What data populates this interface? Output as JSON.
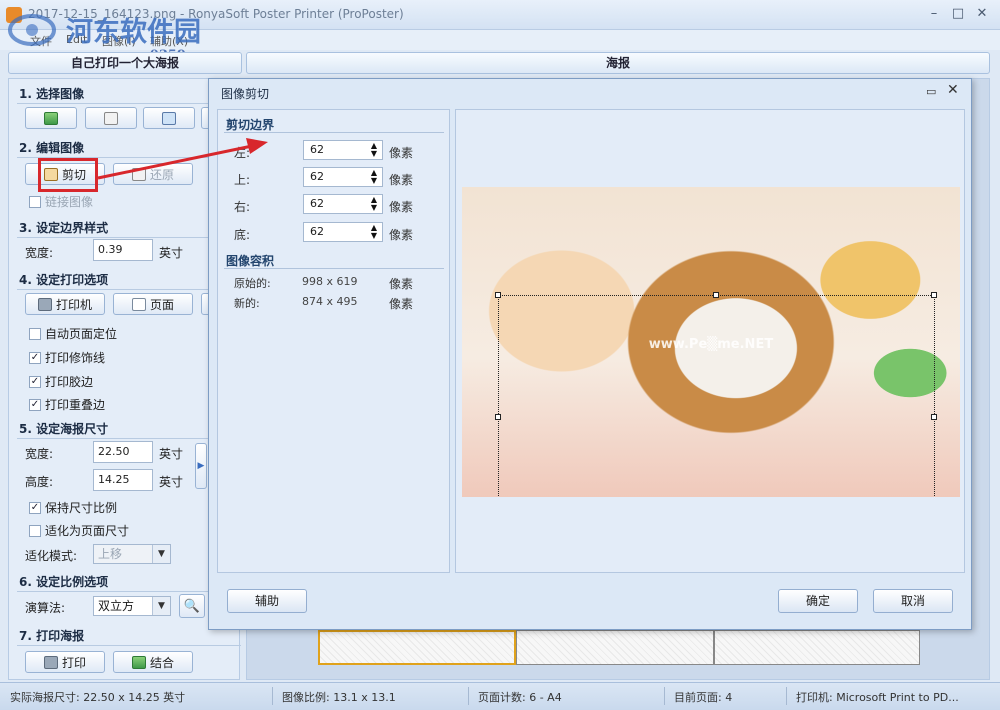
{
  "window": {
    "title": "2017-12-15_164123.png - RonyaSoft Poster Printer (ProPoster)",
    "watermark_title": "河东软件园",
    "watermark_url": "www.pc0359.cn",
    "minimize": "–",
    "maximize": "□",
    "close": "✕"
  },
  "menu": [
    "文件",
    "Edit",
    "图像(I)",
    "辅助(X)"
  ],
  "top_tabs": [
    "自己打印一个大海报",
    "海报"
  ],
  "left_panel": {
    "select_image": {
      "title": "1. 选择图像"
    },
    "edit_image": {
      "title": "2. 编辑图像",
      "crop": "剪切",
      "restore": "还原",
      "link_image": "链接图像"
    },
    "border_style": {
      "title": "3. 设定边界样式",
      "width_label": "宽度:",
      "width_value": "0.39",
      "unit": "英寸"
    },
    "print_options": {
      "title": "4. 设定打印选项",
      "printer": "打印机",
      "page": "页面",
      "checks": [
        {
          "label": "自动页面定位",
          "checked": false
        },
        {
          "label": "打印修饰线",
          "checked": true
        },
        {
          "label": "打印胶边",
          "checked": true
        },
        {
          "label": "打印重叠边",
          "checked": true
        }
      ]
    },
    "poster_size": {
      "title": "5. 设定海报尺寸",
      "width_label": "宽度:",
      "width_value": "22.50",
      "height_label": "高度:",
      "height_value": "14.25",
      "unit": "英寸",
      "keep_ratio": {
        "label": "保持尺寸比例",
        "checked": true
      },
      "fit_page": {
        "label": "适化为页面尺寸",
        "checked": false
      },
      "fit_mode_label": "适化模式:",
      "fit_mode_value": "上移"
    },
    "scale_options": {
      "title": "6. 设定比例选项",
      "algo_label": "演算法:",
      "algo_value": "双立方"
    },
    "print_poster": {
      "title": "7. 打印海报",
      "print": "打印",
      "combine": "结合"
    }
  },
  "status_bar": {
    "actual_size": "实际海报尺寸: 22.50 x 14.25 英寸",
    "image_ratio": "图像比例: 13.1 x 13.1",
    "page_count": "页面计数: 6 - A4",
    "current_page": "目前页面: 4",
    "printer": "打印机: Microsoft Print to PD..."
  },
  "dialog": {
    "title": "图像剪切",
    "crop_border": "剪切边界",
    "unit": "像素",
    "fields": [
      {
        "label": "左:",
        "value": "62"
      },
      {
        "label": "上:",
        "value": "62"
      },
      {
        "label": "右:",
        "value": "62"
      },
      {
        "label": "底:",
        "value": "62"
      }
    ],
    "image_size": "图像容积",
    "original_label": "原始的:",
    "original_value": "998 x 619",
    "new_label": "新的:",
    "new_value": "874 x 495",
    "help": "辅助",
    "ok": "确定",
    "cancel": "取消",
    "photo_watermark": "www.Pe▒me.NET"
  },
  "colors": {
    "annotation": "#d8272c",
    "accent": "#3a6dbf"
  }
}
